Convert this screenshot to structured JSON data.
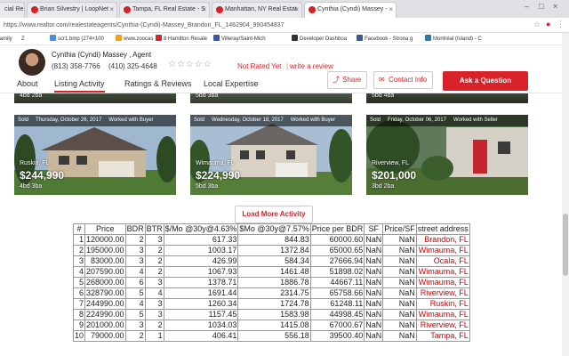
{
  "browser": {
    "tabs": [
      {
        "label": "cial Re",
        "color": "#888"
      },
      {
        "label": "Brian Silvestry | LoopNet",
        "color": "#d92228"
      },
      {
        "label": "Tampa, FL Real Estate - S",
        "color": "#d92228"
      },
      {
        "label": "Manhattan, NY Real Estat",
        "color": "#d92228"
      },
      {
        "label": "Cynthia (Cyndi) Massey -",
        "color": "#d92228"
      }
    ],
    "url": "https://www.realtor.com/realestateagents/Cynthia-(Cyndi)-Massey_Brandon_FL_1462904_990454837",
    "bookmarks": [
      {
        "label": "family",
        "color": "#ffffff"
      },
      {
        "label": "Z",
        "color": "#777"
      },
      {
        "label": "scr1.bmp (274×100",
        "color": "#4a90d9"
      },
      {
        "label": "www.zoocas",
        "color": "#f0a020"
      },
      {
        "label": "8 Hamilton Resale",
        "color": "#d92228"
      },
      {
        "label": "Villeray/Saint-Mich",
        "color": "#3b5998"
      },
      {
        "label": "Developer Dashboa",
        "color": "#333"
      },
      {
        "label": "Facebook - Strona g",
        "color": "#3b5998"
      },
      {
        "label": "Montréal (Island) - C",
        "color": "#2a7ab0"
      }
    ]
  },
  "agent": {
    "name": "Cynthia (Cyndi) Massey , Agent",
    "phone1": "(813) 358-7766",
    "phone2": "(410) 325-4648",
    "stars": "☆☆☆☆☆",
    "rating": "Not Rated Yet",
    "separator": "|",
    "review_link": "write a review"
  },
  "nav": {
    "tabs": [
      "About",
      "Listing Activity",
      "Ratings & Reviews",
      "Local Expertise"
    ],
    "share": "Share",
    "contact": "Contact Info",
    "ask": "Ask a Question"
  },
  "top_cards": [
    {
      "beds": "4bd 2ba"
    },
    {
      "beds": "5bd 3ba"
    },
    {
      "beds": "5bd 4ba"
    }
  ],
  "listings": [
    {
      "status": "Sold",
      "date": "Thursday, October 26, 2017",
      "worked": "Worked with Buyer",
      "city": "Ruskin, FL",
      "price": "$244,990",
      "beds": "4bd 3ba"
    },
    {
      "status": "Sold",
      "date": "Wednesday, October 18, 2017",
      "worked": "Worked with Buyer",
      "city": "Wimauma, FL",
      "price": "$224,990",
      "beds": "5bd 3ba"
    },
    {
      "status": "Sold",
      "date": "Friday, October 06, 2017",
      "worked": "Worked with Seller",
      "city": "Riverview, FL",
      "price": "$201,000",
      "beds": "3bd 2ba"
    }
  ],
  "load_more": "Load More Activity",
  "table": {
    "headers": [
      "#",
      "Price",
      "BDR",
      "BTR",
      "$/Mo @30y@4.63%",
      "$Mo @30y@7.57%",
      "Price per BDR",
      "SF",
      "Price/SF",
      "street address"
    ],
    "rows": [
      [
        "1",
        "120000.00",
        "2",
        "3",
        "617.33",
        "844.83",
        "60000.60",
        "NaN",
        "NaN",
        "Brandon, FL"
      ],
      [
        "2",
        "195000.00",
        "3",
        "2",
        "1003.17",
        "1372.84",
        "65000.65",
        "NaN",
        "NaN",
        "Wimauma, FL"
      ],
      [
        "3",
        "83000.00",
        "3",
        "2",
        "426.99",
        "584.34",
        "27666.94",
        "NaN",
        "NaN",
        "Ocala, FL"
      ],
      [
        "4",
        "207590.00",
        "4",
        "2",
        "1067.93",
        "1461.48",
        "51898.02",
        "NaN",
        "NaN",
        "Wimauma, FL"
      ],
      [
        "5",
        "268000.00",
        "6",
        "3",
        "1378.71",
        "1886.78",
        "44667.11",
        "NaN",
        "NaN",
        "Wimauma, FL"
      ],
      [
        "6",
        "328790.00",
        "5",
        "4",
        "1691.44",
        "2314.75",
        "65758.66",
        "NaN",
        "NaN",
        "Riverview, FL"
      ],
      [
        "7",
        "244990.00",
        "4",
        "3",
        "1260.34",
        "1724.78",
        "61248.11",
        "NaN",
        "NaN",
        "Ruskin, FL"
      ],
      [
        "8",
        "224990.00",
        "5",
        "3",
        "1157.45",
        "1583.98",
        "44998.45",
        "NaN",
        "NaN",
        "Wimauma, FL"
      ],
      [
        "9",
        "201000.00",
        "3",
        "2",
        "1034.03",
        "1415.08",
        "67000.67",
        "NaN",
        "NaN",
        "Riverview, FL"
      ],
      [
        "10",
        "79000.00",
        "2",
        "1",
        "406.41",
        "556.18",
        "39500.40",
        "NaN",
        "NaN",
        "Tampa, FL"
      ]
    ]
  }
}
